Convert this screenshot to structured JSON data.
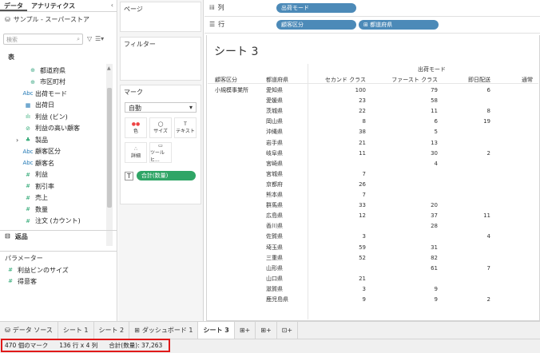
{
  "left": {
    "tabs": [
      "データ",
      "アナリティクス"
    ],
    "datasource": "サンプル - スーパーストア",
    "search_placeholder": "検索",
    "section_table": "表",
    "fields": [
      {
        "icon": "globe-icon",
        "label": "都道府県"
      },
      {
        "icon": "globe-icon",
        "label": "市区町村"
      },
      {
        "icon": "abc-icon",
        "label": "出荷モード"
      },
      {
        "icon": "calendar-icon",
        "label": "出荷日"
      },
      {
        "icon": "bar-icon",
        "label": "利益 (ビン)"
      },
      {
        "icon": "set-icon",
        "label": "利益の高い顧客"
      },
      {
        "icon": "hierarchy-icon",
        "label": "製品"
      },
      {
        "icon": "abc-icon",
        "label": "顧客区分"
      },
      {
        "icon": "abc-icon",
        "label": "顧客名"
      },
      {
        "icon": "hash-icon",
        "label": "利益"
      },
      {
        "icon": "hash-icon",
        "label": "割引率"
      },
      {
        "icon": "hash-icon",
        "label": "売上"
      },
      {
        "icon": "hash-icon",
        "label": "数量"
      },
      {
        "icon": "hash-icon",
        "label": "注文 (カウント)"
      }
    ],
    "returns": "返品",
    "section_params": "パラメーター",
    "params": [
      {
        "icon": "hash-icon",
        "label": "利益ビンのサイズ"
      },
      {
        "icon": "hash-icon",
        "label": "得意客"
      }
    ]
  },
  "shelves": {
    "pages": "ページ",
    "filters": "フィルター",
    "marks": "マーク",
    "mark_type": "自動",
    "mark_buttons": [
      "色",
      "サイズ",
      "テキスト",
      "詳細",
      "ツールヒ..."
    ],
    "mark_pill": "合計(数量)",
    "columns_label": "列",
    "rows_label": "行",
    "columns_pill": "出荷モード",
    "rows_pills": [
      "顧客区分",
      "⊞ 都道府県"
    ]
  },
  "sheet": {
    "title": "シート 3",
    "col_group": "出荷モード",
    "row_headers": [
      "顧客区分",
      "都道府県"
    ],
    "col_headers": [
      "セカンド クラス",
      "ファースト クラス",
      "即日配送",
      "通常"
    ],
    "segment": "小規模事業所",
    "rows": [
      [
        "愛知県",
        "100",
        "79",
        "6"
      ],
      [
        "愛媛県",
        "23",
        "58",
        ""
      ],
      [
        "茨城県",
        "22",
        "11",
        "8"
      ],
      [
        "岡山県",
        "8",
        "6",
        "19"
      ],
      [
        "沖縄県",
        "38",
        "5",
        ""
      ],
      [
        "岩手県",
        "21",
        "13",
        ""
      ],
      [
        "岐阜県",
        "11",
        "30",
        "2"
      ],
      [
        "宮崎県",
        "",
        "4",
        ""
      ],
      [
        "宮城県",
        "7",
        "",
        ""
      ],
      [
        "京都府",
        "26",
        "",
        ""
      ],
      [
        "熊本県",
        "7",
        "",
        ""
      ],
      [
        "群馬県",
        "33",
        "20",
        ""
      ],
      [
        "広島県",
        "12",
        "37",
        "11"
      ],
      [
        "香川県",
        "",
        "28",
        ""
      ],
      [
        "佐賀県",
        "3",
        "",
        "4"
      ],
      [
        "埼玉県",
        "59",
        "31",
        ""
      ],
      [
        "三重県",
        "52",
        "82",
        ""
      ],
      [
        "山形県",
        "",
        "61",
        "7"
      ],
      [
        "山口県",
        "21",
        "",
        ""
      ],
      [
        "滋賀県",
        "3",
        "9",
        ""
      ],
      [
        "鹿児島県",
        "9",
        "9",
        "2"
      ]
    ]
  },
  "bottom_tabs": [
    "データ ソース",
    "シート 1",
    "シート 2",
    "ダッシュボード 1",
    "シート 3"
  ],
  "status": {
    "marks": "470 個のマーク",
    "dims": "136 行 x 4 列",
    "sum": "合計(数量): 37,263"
  }
}
